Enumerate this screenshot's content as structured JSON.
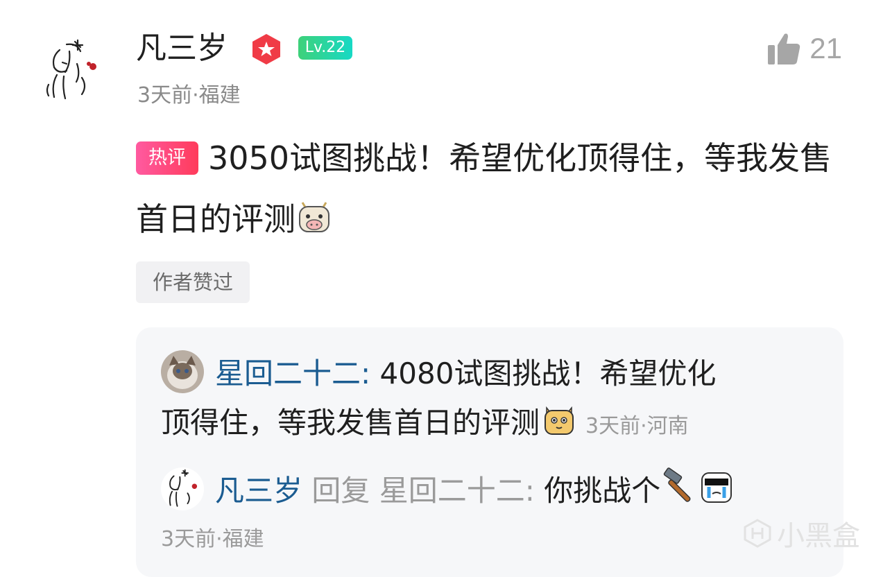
{
  "comment": {
    "author": "凡三岁",
    "level": "Lv.22",
    "likes": "21",
    "meta": "3天前·福建",
    "hot_tag": "热评",
    "text": "3050试图挑战！希望优化顶得住，等我发售首日的评测",
    "author_liked": "作者赞过"
  },
  "replies": [
    {
      "user": "星回二十二",
      "separator": ": ",
      "text_line1": "4080试图挑战！希望优化",
      "text_line2": "顶得住，等我发售首日的评测",
      "meta": "3天前·河南"
    },
    {
      "user": "凡三岁",
      "reply_word": "回复",
      "reply_to": "星回二十二",
      "separator": ": ",
      "text": "你挑战个",
      "meta": "3天前·福建"
    }
  ],
  "watermark": "小黑盒",
  "icons": {
    "star_badge": "star-badge-icon",
    "like": "thumbs-up-icon",
    "emoji_cow": "cow-emoji-icon",
    "emoji_dog": "dog-emoji-icon",
    "emoji_hammer": "hammer-emoji-icon",
    "emoji_cry": "crying-sunglasses-emoji-icon"
  },
  "colors": {
    "username_blue": "#1b5c91",
    "hot_tag": "#ff4d7d",
    "level_badge": "#3ed17a"
  }
}
